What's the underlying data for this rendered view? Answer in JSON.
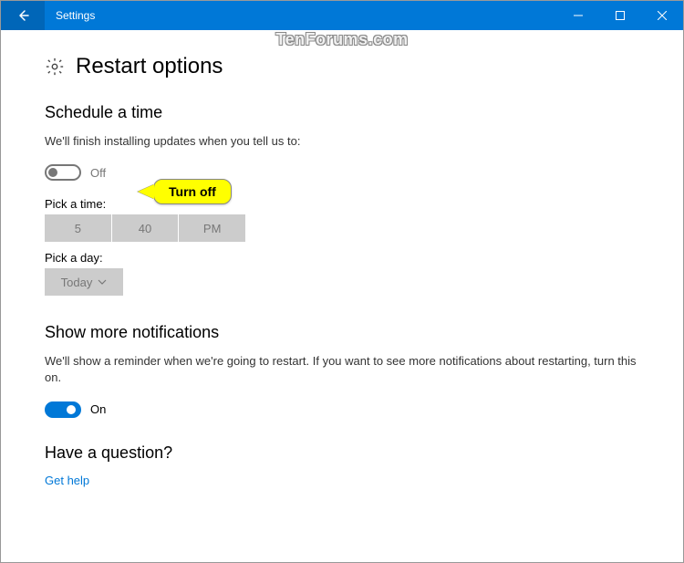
{
  "titlebar": {
    "app_title": "Settings"
  },
  "watermark": "TenForums.com",
  "page": {
    "title": "Restart options"
  },
  "schedule": {
    "heading": "Schedule a time",
    "description": "We'll finish installing updates when you tell us to:",
    "toggle_state": "Off",
    "pick_time_label": "Pick a time:",
    "time": {
      "hour": "5",
      "minute": "40",
      "ampm": "PM"
    },
    "pick_day_label": "Pick a day:",
    "day": "Today"
  },
  "callout": {
    "text": "Turn off"
  },
  "notifications": {
    "heading": "Show more notifications",
    "description": "We'll show a reminder when we're going to restart. If you want to see more notifications about restarting, turn this on.",
    "toggle_state": "On"
  },
  "question": {
    "heading": "Have a question?",
    "link": "Get help"
  }
}
